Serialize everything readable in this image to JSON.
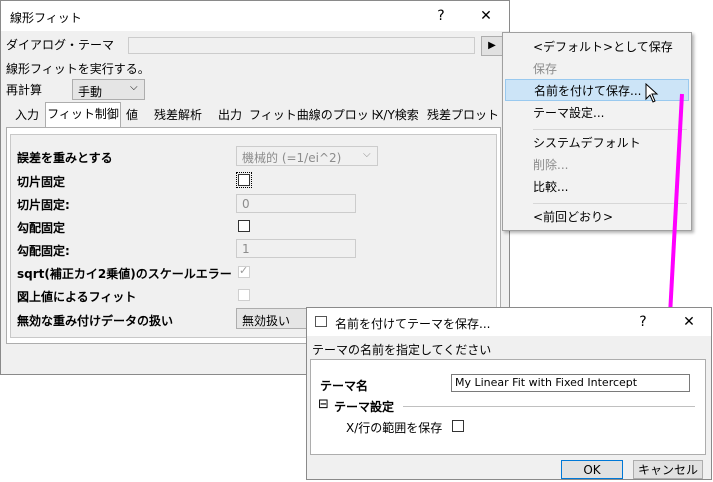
{
  "main_dialog": {
    "title": "線形フィット",
    "help_glyph": "?",
    "close_glyph": "✕",
    "theme_label": "ダイアログ・テーマ",
    "theme_value": "",
    "theme_menu_glyph": "▶",
    "description": "線形フィットを実行する。",
    "recalc_label": "再計算",
    "recalc_value": "手動",
    "tabs": [
      "入力",
      "フィット制御",
      "値",
      "残差解析",
      "出力",
      "フィット曲線のプロット",
      "X/Y検索",
      "残差プロット"
    ],
    "rows": [
      {
        "label": "誤差を重みとする",
        "value": "機械的 (=1/ei^2)"
      },
      {
        "label": "切片固定"
      },
      {
        "label": "切片固定:",
        "value": "0"
      },
      {
        "label": "勾配固定"
      },
      {
        "label": "勾配固定:",
        "value": "1"
      },
      {
        "label": "sqrt(補正カイ2乗値)のスケールエラー"
      },
      {
        "label": "図上値によるフィット"
      },
      {
        "label": "無効な重み付けデータの扱い",
        "value": "無効扱い"
      }
    ]
  },
  "theme_menu": {
    "items": [
      {
        "label": "<デフォルト>として保存",
        "disabled": false
      },
      {
        "label": "保存",
        "disabled": true
      },
      {
        "label": "名前を付けて保存...",
        "disabled": false,
        "highlighted": true
      },
      {
        "label": "テーマ設定...",
        "disabled": false
      },
      {
        "label": "システムデフォルト",
        "disabled": false
      },
      {
        "label": "削除...",
        "disabled": true
      },
      {
        "label": "比較...",
        "disabled": false
      },
      {
        "label": "<前回どおり>",
        "disabled": false
      }
    ]
  },
  "save_dialog": {
    "title": "名前を付けてテーマを保存...",
    "help_glyph": "?",
    "close_glyph": "✕",
    "instruction": "テーマの名前を指定してください",
    "name_label": "テーマ名",
    "name_value": "My Linear Fit with Fixed Intercept",
    "section_toggle": "⊟",
    "section_label": "テーマ設定",
    "xy_label": "X/行の範囲を保存",
    "ok_label": "OK",
    "cancel_label": "キャンセル"
  },
  "colors": {
    "arrow": "#ff00ff",
    "highlight": "#cce4f7",
    "accent": "#0078d7"
  }
}
